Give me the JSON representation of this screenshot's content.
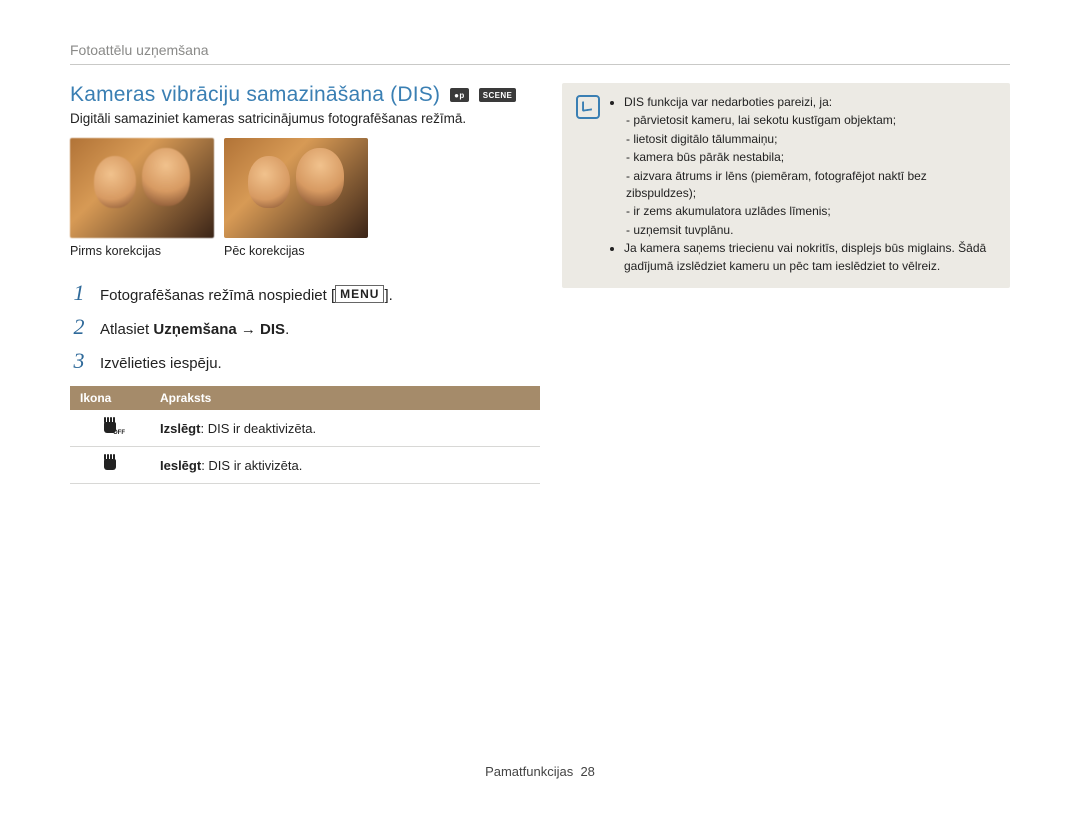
{
  "breadcrumb": "Fotoattēlu uzņemšana",
  "section": {
    "title": "Kameras vibrāciju samazināšana (DIS)",
    "mode_icons": [
      "●p",
      "SCENE"
    ],
    "intro": "Digitāli samaziniet kameras satricinājumus fotografēšanas režīmā.",
    "before_caption": "Pirms korekcijas",
    "after_caption": "Pēc korekcijas"
  },
  "steps": [
    {
      "num": "1",
      "text_pre": "Fotografēšanas režīmā nospiediet [",
      "menu": "MENU",
      "text_post": "]."
    },
    {
      "num": "2",
      "text_a": "Atlasiet ",
      "bold": "Uzņemšana → DIS",
      "text_b": "."
    },
    {
      "num": "3",
      "text_pre": "Izvēlieties iespēju."
    }
  ],
  "table": {
    "head_icon": "Ikona",
    "head_desc": "Apraksts",
    "rows": [
      {
        "icon": "hand-off",
        "label": "Izslēgt",
        "desc": ": DIS ir deaktivizēta."
      },
      {
        "icon": "hand-on",
        "label": "Ieslēgt",
        "desc": ": DIS ir aktivizēta."
      }
    ]
  },
  "note": {
    "line1": "DIS funkcija var nedarboties pareizi, ja:",
    "bullets_a": [
      "pārvietosit kameru, lai sekotu kustīgam objektam;",
      "lietosit digitālo tālummaiņu;",
      "kamera būs pārāk nestabila;",
      "aizvara ātrums ir lēns (piemēram, fotografējot naktī bez zibspuldzes);",
      "ir zems akumulatora uzlādes līmenis;",
      "uzņemsit tuvplānu."
    ],
    "line2": "Ja kamera saņems triecienu vai nokritīs, displejs būs miglains. Šādā gadījumā izslēdziet kameru un pēc tam ieslēdziet to vēlreiz."
  },
  "footer": {
    "label": "Pamatfunkcijas",
    "page": "28"
  }
}
